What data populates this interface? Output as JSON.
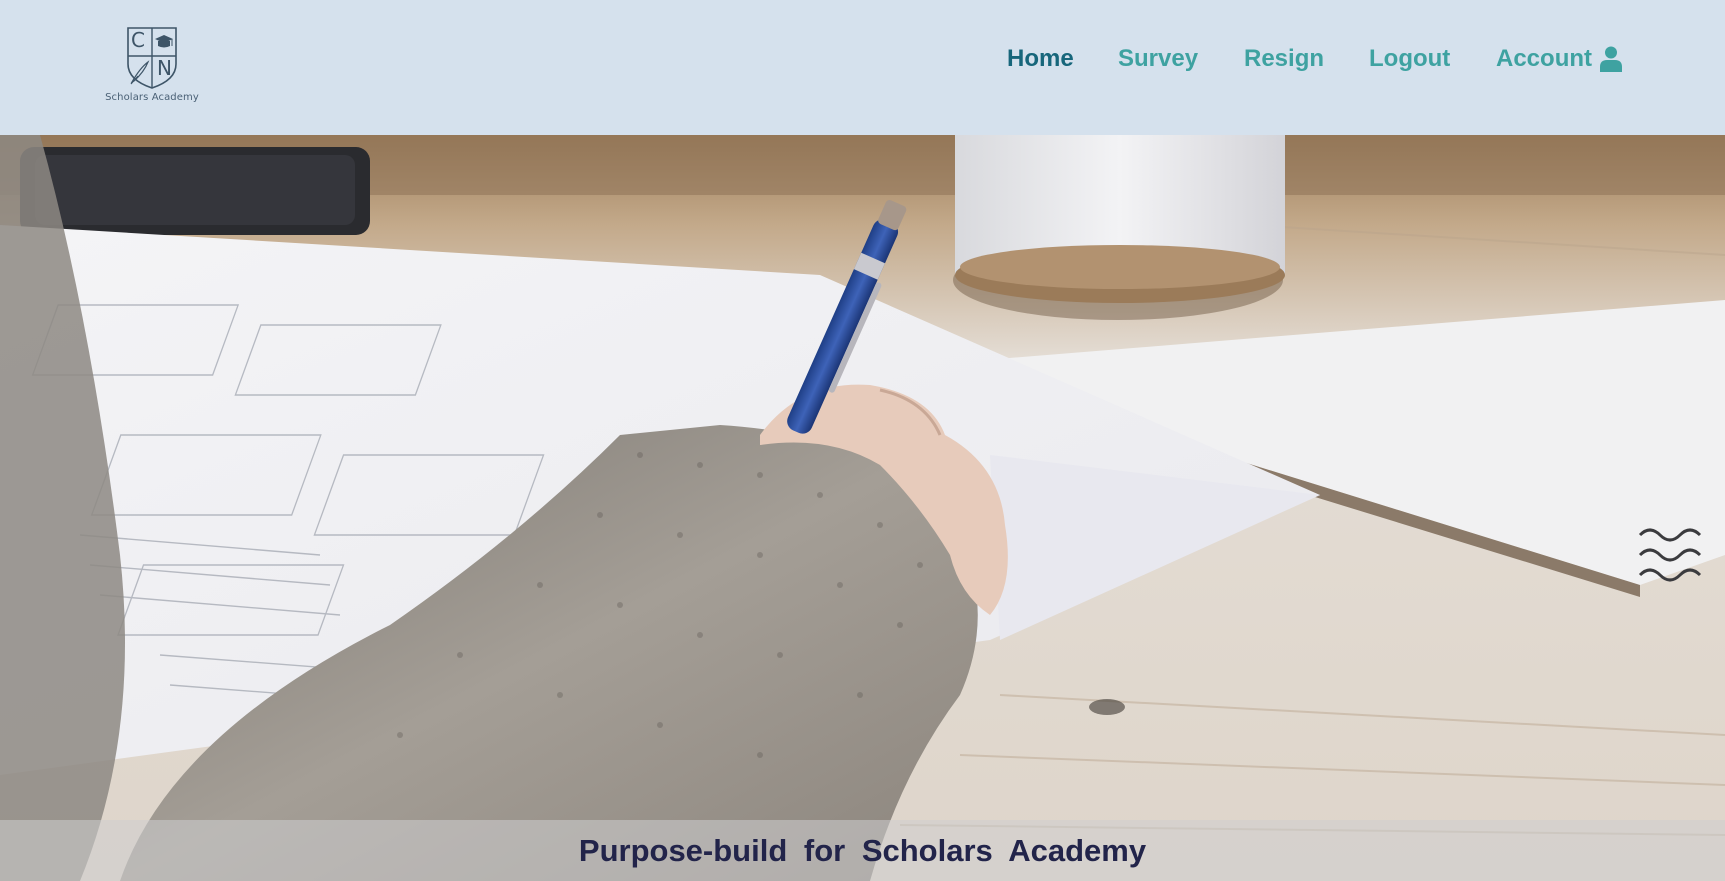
{
  "header": {
    "logo": {
      "monogram_left": "C",
      "monogram_right": "N",
      "text": "Scholars Academy",
      "icon": "graduation-cap-shield-icon"
    },
    "nav": {
      "home": "Home",
      "survey": "Survey",
      "resign": "Resign",
      "logout": "Logout",
      "account": "Account",
      "account_icon": "user-icon"
    },
    "colors": {
      "background": "#d5e1ed",
      "nav_active": "#17667b",
      "nav_default": "#3ea2a1"
    }
  },
  "hero": {
    "image": "person-writing-with-pen-on-paper",
    "caption": "Purpose-build for Scholars Academy",
    "caption_color": "#22244a"
  }
}
